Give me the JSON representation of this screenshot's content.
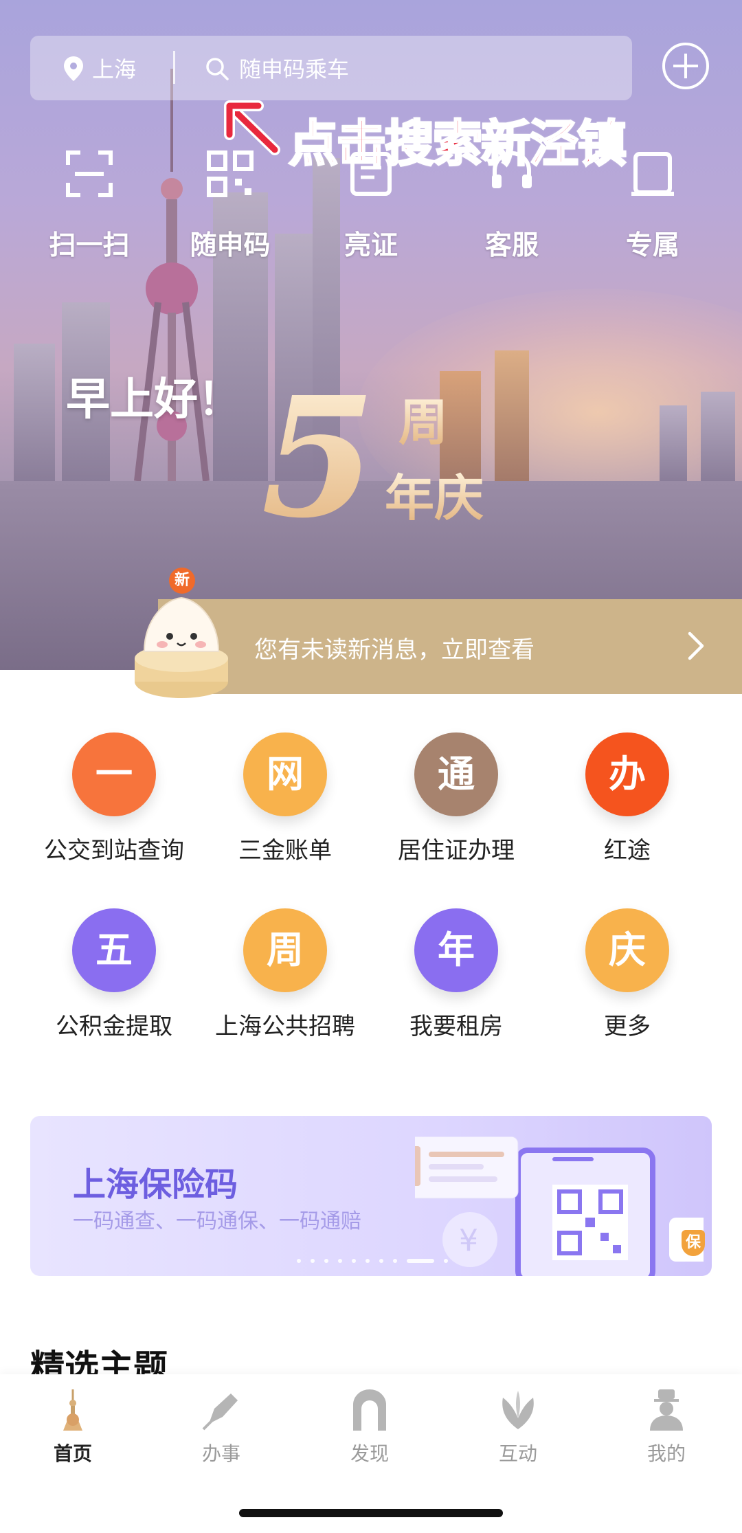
{
  "header": {
    "city": "上海",
    "search_placeholder": "随申码乘车"
  },
  "annotation": {
    "text": "点击搜索新泾镇"
  },
  "quick_actions": [
    {
      "label": "扫一扫",
      "icon": "scan-icon"
    },
    {
      "label": "随申码",
      "icon": "qr-code-icon"
    },
    {
      "label": "亮证",
      "icon": "id-card-icon"
    },
    {
      "label": "客服",
      "icon": "customer-service-icon"
    },
    {
      "label": "专属",
      "icon": "exclusive-icon"
    }
  ],
  "hero": {
    "greeting": "早上好！",
    "anniversary": {
      "number": "5",
      "text_top": "周",
      "text_bottom": "年庆"
    }
  },
  "message_bar": {
    "badge": "新",
    "text": "您有未读新消息，立即查看"
  },
  "services": [
    {
      "glyph": "一",
      "label": "公交到站查询",
      "color": "#f7743c"
    },
    {
      "glyph": "网",
      "label": "三金账单",
      "color": "#f8b24c"
    },
    {
      "glyph": "通",
      "label": "居住证办理",
      "color": "#a7836e"
    },
    {
      "glyph": "办",
      "label": "红途",
      "color": "#f5541e"
    },
    {
      "glyph": "五",
      "label": "公积金提取",
      "color": "#8a6ef0"
    },
    {
      "glyph": "周",
      "label": "上海公共招聘",
      "color": "#f8b24c"
    },
    {
      "glyph": "年",
      "label": "我要租房",
      "color": "#8a6ef0"
    },
    {
      "glyph": "庆",
      "label": "更多",
      "color": "#f8b24c"
    }
  ],
  "banner": {
    "title": "上海保险码",
    "subtitle": "一码通查、一码通保、一码通赔",
    "badge": "保",
    "slide_count": 10,
    "active_slide": 9
  },
  "section": {
    "title": "精选主题"
  },
  "tabs": [
    {
      "label": "首页",
      "icon": "home-tower-icon",
      "active": true
    },
    {
      "label": "办事",
      "icon": "pen-icon",
      "active": false
    },
    {
      "label": "发现",
      "icon": "discover-arch-icon",
      "active": false
    },
    {
      "label": "互动",
      "icon": "interact-flower-icon",
      "active": false
    },
    {
      "label": "我的",
      "icon": "profile-icon",
      "active": false
    }
  ],
  "colors": {
    "accent_gold": "#cdb48a",
    "annotation_red": "#e8283d",
    "banner_purple": "#6d5ee0"
  }
}
